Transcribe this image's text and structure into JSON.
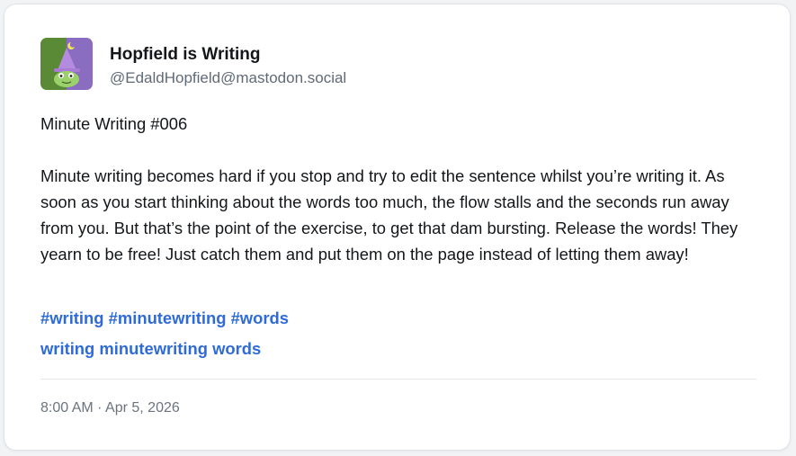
{
  "post": {
    "author": {
      "display_name": "Hopfield is Writing",
      "handle": "@EdaldHopfield@mastodon.social",
      "avatar_icon": "frog-witch-avatar-icon"
    },
    "title_line": "Minute Writing #006",
    "body": "Minute writing becomes hard if you stop and try to edit the sentence whilst you’re writing it. As soon as you start thinking about the words too much, the flow stalls and the seconds run away from you. But that’s the point of the exercise, to get that dam bursting. Release the words! They yearn to be free! Just catch them and put them on the page instead of letting them away!",
    "hashtags": [
      "#writing",
      "#minutewriting",
      "#words"
    ],
    "tags": [
      "writing",
      "minutewriting",
      "words"
    ],
    "timestamp": "8:00 AM · Apr 5, 2026"
  },
  "colors": {
    "link": "#2f6bd8",
    "text": "#14171a",
    "muted": "#606a76",
    "avatar_bg_left": "#5b8a36",
    "avatar_bg_right": "#8a6cc0"
  }
}
